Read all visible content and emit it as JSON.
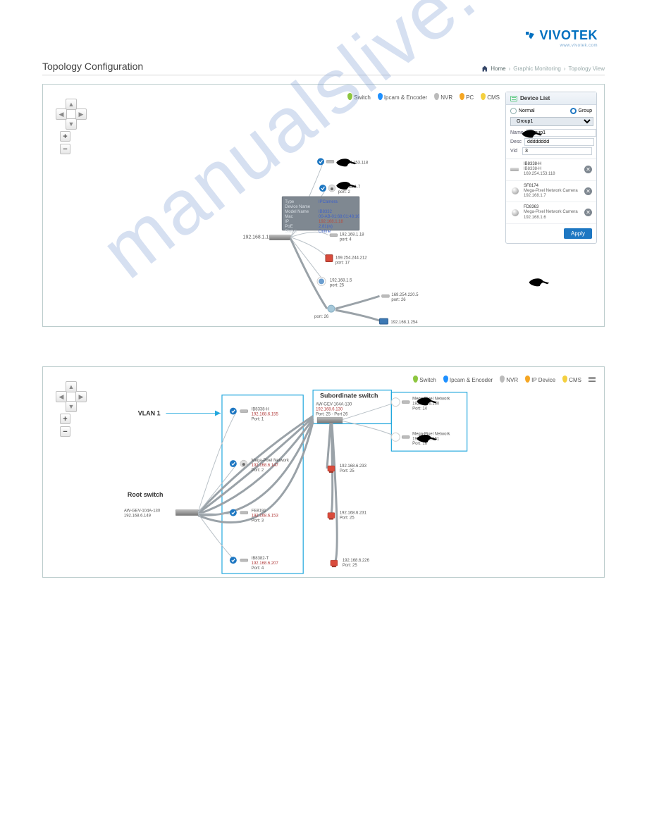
{
  "header": {
    "logo_text": "VIVOTEK",
    "logo_sub": "www.vivotek.com",
    "page_title": "Topology Configuration"
  },
  "breadcrumb": {
    "home": "Home",
    "section": "Graphic Monitoring",
    "page": "Topology View"
  },
  "legend1": {
    "switch": "Switch",
    "ipcam": "Ipcam & Encoder",
    "nvr": "NVR",
    "pc": "PC",
    "cms": "CMS"
  },
  "legend2": {
    "switch": "Switch",
    "ipcam": "Ipcam & Encoder",
    "nvr": "NVR",
    "ipdev": "IP Device",
    "cms": "CMS"
  },
  "device_list": {
    "title": "Device List",
    "mode_normal": "Normal",
    "mode_group": "Group",
    "group_select": "Group1",
    "name_label": "Name",
    "name_value": "Group1",
    "desc_label": "Desc",
    "desc_value": "dddddddd",
    "vid_label": "Vid",
    "vid_value": "3",
    "items": [
      {
        "line1": "IB8338-H",
        "line2": "IB8338-H",
        "line3": "169.254.153.118",
        "cam": "bullet"
      },
      {
        "line1": "SF8174",
        "line2": "Mega-Pixel Network Camera",
        "line3": "192.168.1.7",
        "cam": "dome"
      },
      {
        "line1": "FD8363",
        "line2": "Mega-Pixel Network Camera",
        "line3": "192.168.1.6",
        "cam": "dome"
      }
    ],
    "apply": "Apply"
  },
  "topology1": {
    "root_ip": "192.168.1.1",
    "info": {
      "type_k": "Type",
      "type_v": "IPCamera",
      "name_k": "Device Name",
      "name_v": "",
      "model_k": "Model Name",
      "model_v": "IB8332",
      "mac_k": "Mac",
      "mac_v": "00-AB-01:68:01:48:16",
      "ip_k": "IP",
      "ip_v": "192.168.1.18",
      "poe_k": "PoE",
      "poe_v": "2.81(w)",
      "stat_k": "Status",
      "stat_v": "Online"
    },
    "nodes": {
      "n1": "169.254.153.118",
      "n2_ip": "192.168.1.7",
      "n2_port": "port: 2",
      "n3_ip": "192.168.1.18",
      "n3_port": "port: 4",
      "n4_ip": "169.254.244.212",
      "n4_port": "port: 17",
      "n5_ip": "192.168.1.5",
      "n5_port": "port: 25",
      "n6_ip": "169.254.220.5",
      "n6_port": "port: 26",
      "n7_ip": "192.168.1.254",
      "hub_port": "port: 26"
    }
  },
  "topology2": {
    "vlan_label": "VLAN 1",
    "root_label": "Root switch",
    "root_model": "AW-GEV-104A-130",
    "root_ip": "192.168.6.149",
    "sub_label": "Subordinate switch",
    "sub_model": "AW-GEV-104A-130",
    "sub_ip": "192.168.6.130",
    "sub_ports": "Port: 25 - Port 26",
    "cams": [
      {
        "name": "IB8338-H",
        "ip": "192.168.6.155",
        "port": "Port: 1"
      },
      {
        "name": "Mega-Pixel Network",
        "ip": "192.168.6.147",
        "port": "Port: 2"
      },
      {
        "name": "FE8191",
        "ip": "192.168.6.153",
        "port": "Port: 3"
      },
      {
        "name": "IB8382-T",
        "ip": "192.168.6.207",
        "port": "Port: 4"
      }
    ],
    "right_cams": [
      {
        "name": "Mega-Pixel Network",
        "ip": "192.168.6.160",
        "port": "Port: 14"
      },
      {
        "name": "Mega-Pixel Network",
        "ip": "192.168.6.161",
        "port": "Port: 16"
      }
    ],
    "pcs": [
      {
        "ip": "192.168.6.233",
        "port": "Port: 25"
      },
      {
        "ip": "192.168.6.231",
        "port": "Port: 25"
      },
      {
        "ip": "192.168.6.226",
        "port": "Port: 25"
      }
    ]
  },
  "watermark": "manualslive.com"
}
